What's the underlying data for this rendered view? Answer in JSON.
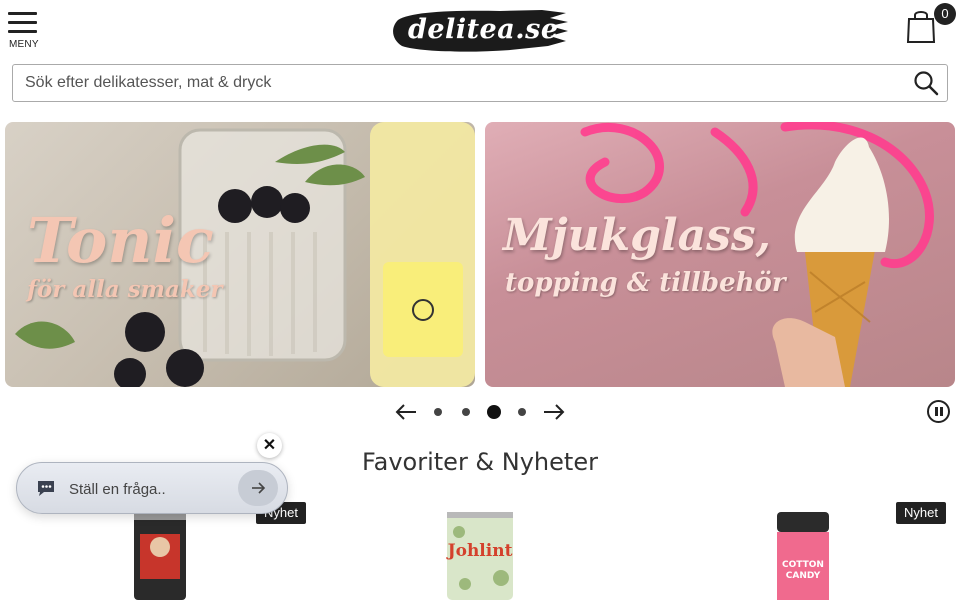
{
  "header": {
    "menu_label": "MENY",
    "logo_text": "delitea.se",
    "cart_count": "0"
  },
  "search": {
    "placeholder": "Sök efter delikatesser, mat & dryck"
  },
  "banners": [
    {
      "title": "Tonic",
      "subtitle": "för alla smaker"
    },
    {
      "title": "Mjukglass,",
      "subtitle": "topping & tillbehör"
    }
  ],
  "carousel": {
    "dot_count": 4,
    "active_dot": 3
  },
  "section": {
    "title": "Favoriter & Nyheter"
  },
  "chat": {
    "placeholder": "Ställ en fråga.."
  },
  "products": [
    {
      "badge": "Nyhet"
    },
    {
      "badge": ""
    },
    {
      "badge": "Nyhet"
    }
  ],
  "colors": {
    "text": "#222222",
    "badge_bg": "#222222",
    "banner_tonic_text": "#f4c6b3",
    "banner_mjuk_text": "#fbe3dc"
  }
}
